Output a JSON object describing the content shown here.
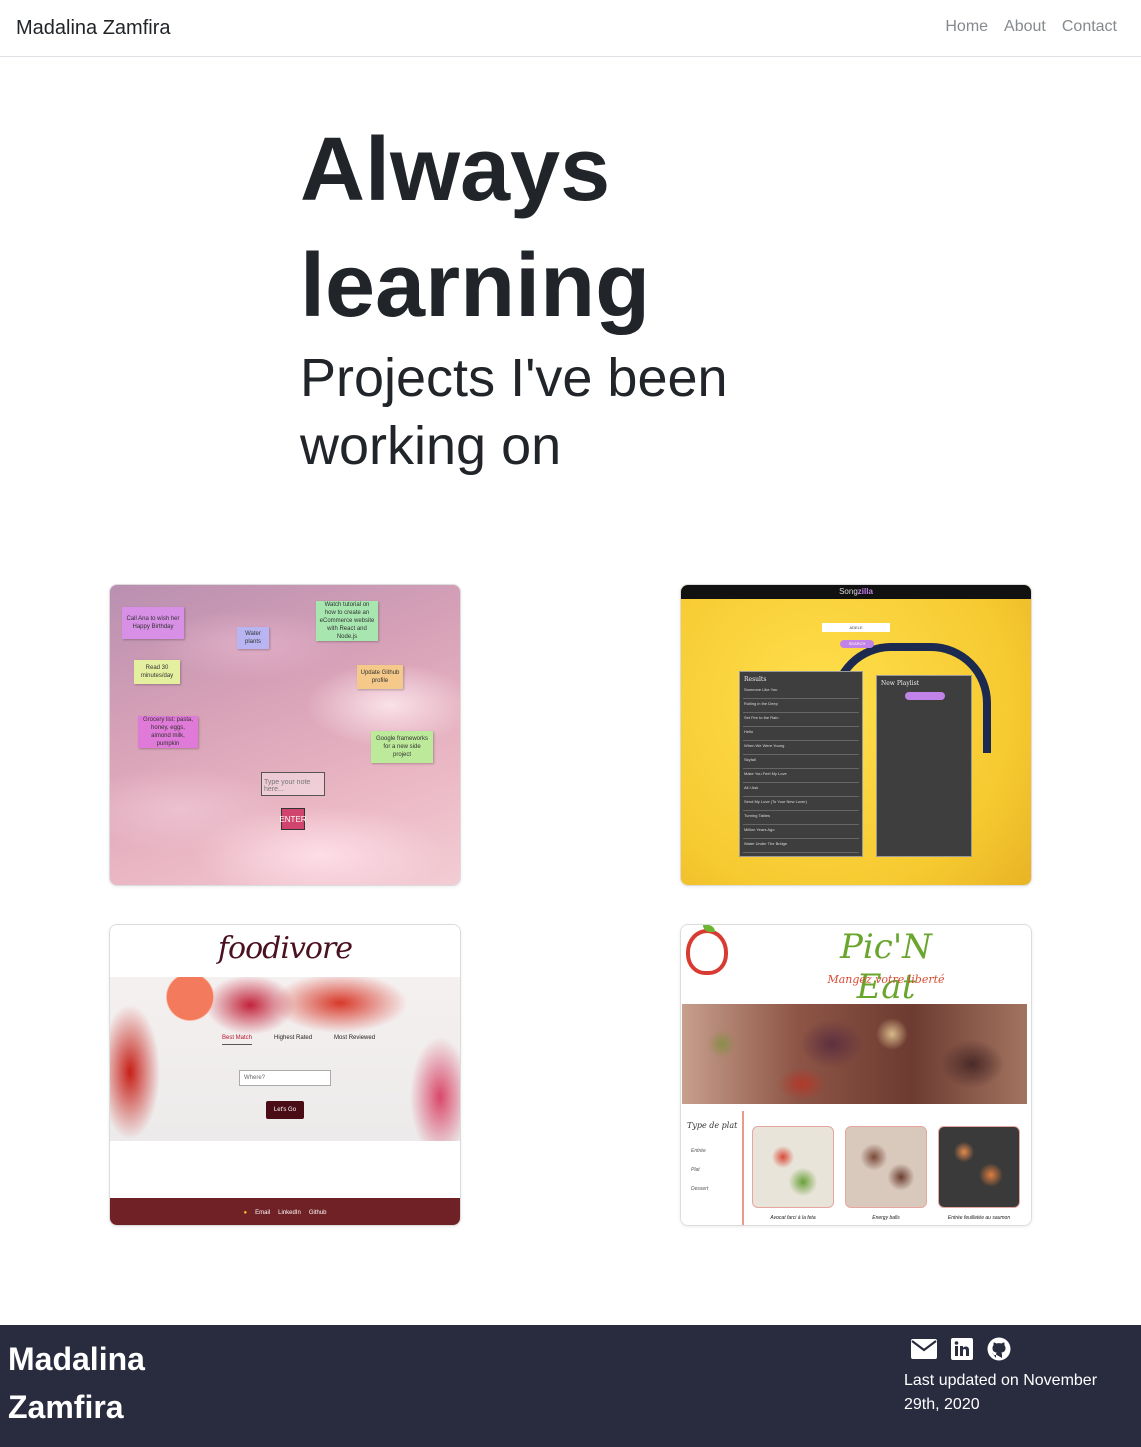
{
  "nav": {
    "brand": "Madalina Zamfira",
    "links": [
      "Home",
      "About",
      "Contact"
    ]
  },
  "hero": {
    "title": "Always learning",
    "subtitle": "Projects I've been working on"
  },
  "projects": {
    "notes": {
      "items": [
        "Call Ana to wish her Happy Birthday",
        "Water plants",
        "Watch tutorial on how to create an eCommerce website with React and Node.js",
        "Read 30 minutes/day",
        "Update Github profile",
        "Grocery list: pasta, honey, eggs, almond milk, pumpkin",
        "Google frameworks for a new side project"
      ],
      "input_placeholder": "Type your note here...",
      "enter_label": "ENTER"
    },
    "songzilla": {
      "brand_prefix": "Song",
      "brand_suffix": "zilla",
      "search_value": "ADELE",
      "search_button": "SEARCH",
      "results_title": "Results",
      "playlist_title": "New Playlist",
      "tracks": [
        "Someone Like You",
        "Rolling in the Deep",
        "Set Fire to the Rain",
        "Hello",
        "When We Were Young",
        "Skyfall",
        "Make You Feel My Love",
        "All I Ask",
        "Send My Love (To Your New Lover)",
        "Turning Tables",
        "Million Years Ago",
        "Water Under The Bridge"
      ]
    },
    "foodivore": {
      "logo": "foodivore",
      "tabs": [
        "Best Match",
        "Highest Rated",
        "Most Reviewed"
      ],
      "input_placeholder": "Where?",
      "button": "Let's Go",
      "footer_links": [
        "Email",
        "LinkedIn",
        "Github"
      ]
    },
    "picneat": {
      "title": "Pic'N Eat",
      "slogan": "Mangez votre liberté",
      "filter_title": "Type de plat",
      "filters": [
        "Entrée",
        "Plat",
        "Dessert"
      ],
      "dishes": [
        "Avocat farci à la feta",
        "Energy balls",
        "Entrée feuilletée au saumon"
      ]
    }
  },
  "footer": {
    "name": "Madalina Zamfira",
    "updated": "Last updated on November 29th, 2020"
  },
  "colors": {
    "footer_bg": "#292b3f",
    "text_dark": "#212529",
    "nav_link": "#858a8f"
  }
}
